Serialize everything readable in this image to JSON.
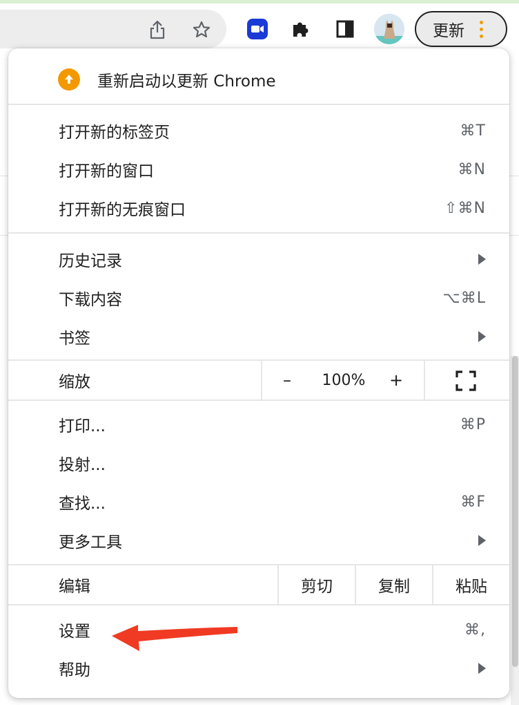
{
  "toolbar": {
    "update_label": "更新"
  },
  "menu": {
    "update_item": "重新启动以更新 Chrome",
    "new_tab": {
      "label": "打开新的标签页",
      "shortcut": "⌘T"
    },
    "new_window": {
      "label": "打开新的窗口",
      "shortcut": "⌘N"
    },
    "new_incognito": {
      "label": "打开新的无痕窗口",
      "shortcut": "⇧⌘N"
    },
    "history": {
      "label": "历史记录"
    },
    "downloads": {
      "label": "下载内容",
      "shortcut": "⌥⌘L"
    },
    "bookmarks": {
      "label": "书签"
    },
    "zoom": {
      "label": "缩放",
      "minus": "–",
      "value": "100%",
      "plus": "+"
    },
    "print": {
      "label": "打印...",
      "shortcut": "⌘P"
    },
    "cast": {
      "label": "投射..."
    },
    "find": {
      "label": "查找...",
      "shortcut": "⌘F"
    },
    "more_tools": {
      "label": "更多工具"
    },
    "edit": {
      "label": "编辑",
      "cut": "剪切",
      "copy": "复制",
      "paste": "粘贴"
    },
    "settings": {
      "label": "设置",
      "shortcut": "⌘,"
    },
    "help": {
      "label": "帮助"
    }
  },
  "colors": {
    "accent": "#f29900",
    "arrow": "#f03a23",
    "zoom_app": "#1a3bd6"
  },
  "icons": [
    "share-icon",
    "star-icon",
    "zoom-meeting-icon",
    "extensions-puzzle-icon",
    "side-panel-icon",
    "profile-avatar",
    "more-menu-icon",
    "update-arrow-icon",
    "submenu-arrow-icon",
    "fullscreen-icon"
  ]
}
